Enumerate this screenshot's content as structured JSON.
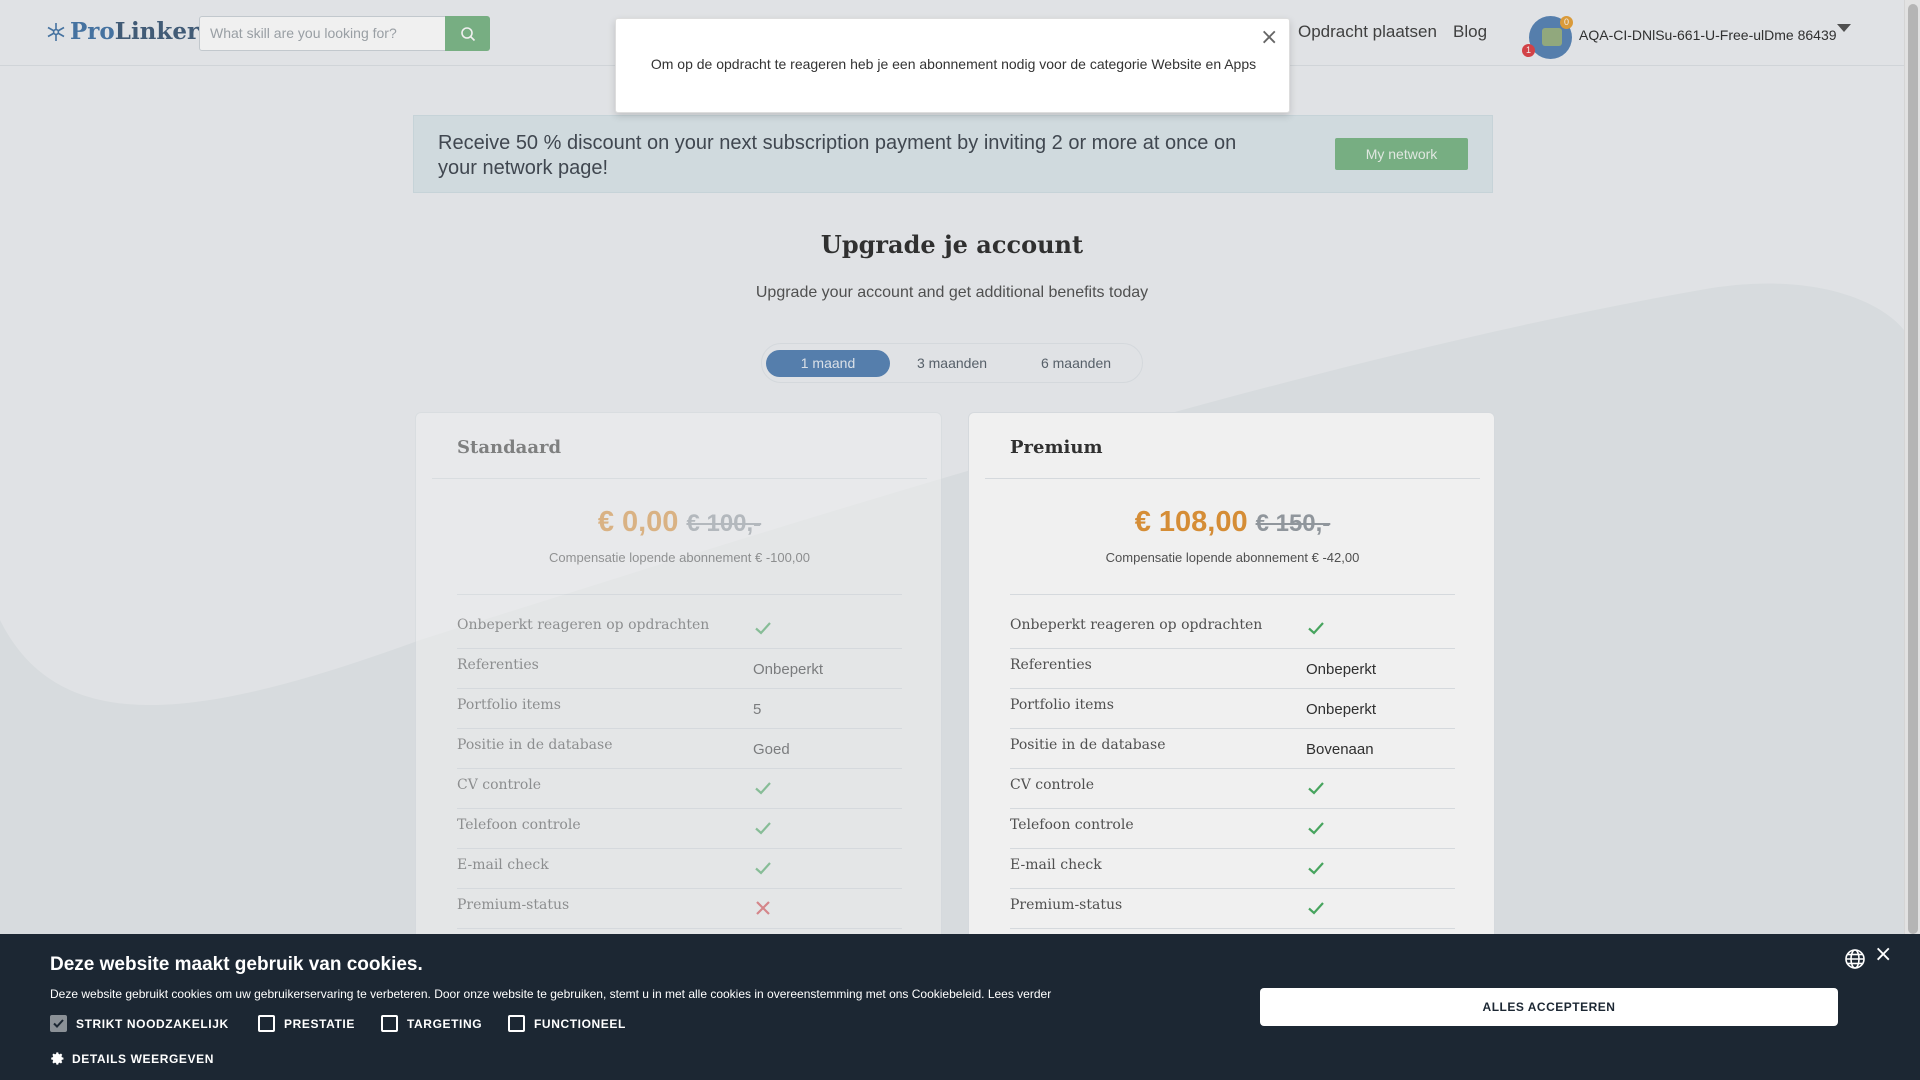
{
  "header": {
    "logo_pro": "Pro",
    "logo_linker": "Linker",
    "search_placeholder": "What skill are you looking for?",
    "nav": [
      "Opdracht plaatsen",
      "Blog"
    ],
    "notification_badge": "1",
    "points_badge": "0",
    "username": "AQA-CI-DNlSu-661-U-Free-ulDme 86439"
  },
  "modal": {
    "text": "Om op de opdracht te reageren heb je een abonnement nodig voor de categorie Website en Apps",
    "close": "×"
  },
  "promo": {
    "text": "Receive 50 % discount on your next subscription payment by inviting 2 or more at once on your network page!",
    "button": "My network"
  },
  "main": {
    "title": "Upgrade je account",
    "subtitle": "Upgrade your account and get additional benefits today",
    "periods": [
      {
        "label": "1 maand",
        "active": true
      },
      {
        "label": "3 maanden",
        "active": false
      },
      {
        "label": "6 maanden",
        "active": false
      }
    ]
  },
  "plans": {
    "standard": {
      "name": "Standaard",
      "price": "€ 0,00",
      "old_price": "€ 100,-",
      "compensation": "Compensatie lopende abonnement € -100,00",
      "features": [
        {
          "label": "Onbeperkt reageren op opdrachten",
          "kind": "check"
        },
        {
          "label": "Referenties",
          "kind": "text",
          "value": "Onbeperkt"
        },
        {
          "label": "Portfolio items",
          "kind": "text",
          "value": "5"
        },
        {
          "label": "Positie in de database",
          "kind": "text",
          "value": "Goed"
        },
        {
          "label": "CV controle",
          "kind": "check"
        },
        {
          "label": "Telefoon controle",
          "kind": "check"
        },
        {
          "label": "E-mail check",
          "kind": "check"
        },
        {
          "label": "Premium-status",
          "kind": "cross"
        }
      ]
    },
    "premium": {
      "name": "Premium",
      "price": "€ 108,00",
      "old_price": "€ 150,-",
      "compensation": "Compensatie lopende abonnement € -42,00",
      "features": [
        {
          "label": "Onbeperkt reageren op opdrachten",
          "kind": "check"
        },
        {
          "label": "Referenties",
          "kind": "text",
          "value": "Onbeperkt"
        },
        {
          "label": "Portfolio items",
          "kind": "text",
          "value": "Onbeperkt"
        },
        {
          "label": "Positie in de database",
          "kind": "text",
          "value": "Bovenaan"
        },
        {
          "label": "CV controle",
          "kind": "check"
        },
        {
          "label": "Telefoon controle",
          "kind": "check"
        },
        {
          "label": "E-mail check",
          "kind": "check"
        },
        {
          "label": "Premium-status",
          "kind": "check"
        }
      ]
    }
  },
  "cookie": {
    "title": "Deze website maakt gebruik van cookies.",
    "text": "Deze website gebruikt cookies om uw gebruikerservaring te verbeteren. Door onze website te gebruiken, stemt u in met alle cookies in overeenstemming met ons Cookiebeleid.",
    "read_more": "Lees verder",
    "categories": [
      {
        "label": "STRIKT NOODZAKELIJK",
        "checked": true
      },
      {
        "label": "PRESTATIE",
        "checked": false
      },
      {
        "label": "TARGETING",
        "checked": false
      },
      {
        "label": "FUNCTIONEEL",
        "checked": false
      }
    ],
    "details": "DETAILS WEERGEVEN",
    "accept": "ALLES ACCEPTEREN"
  },
  "colors": {
    "accent_green": "#7fb98b",
    "accent_blue": "#5b86b7",
    "price_orange": "#e3963a",
    "check_green": "#4caf64",
    "cross_red": "#e0474c",
    "cookie_bg": "#1c2733"
  },
  "icons": {
    "search": "search-icon",
    "check": "check-icon",
    "cross": "cross-icon",
    "globe": "globe-icon",
    "gear": "gear-icon",
    "caret": "chevron-down-icon"
  }
}
